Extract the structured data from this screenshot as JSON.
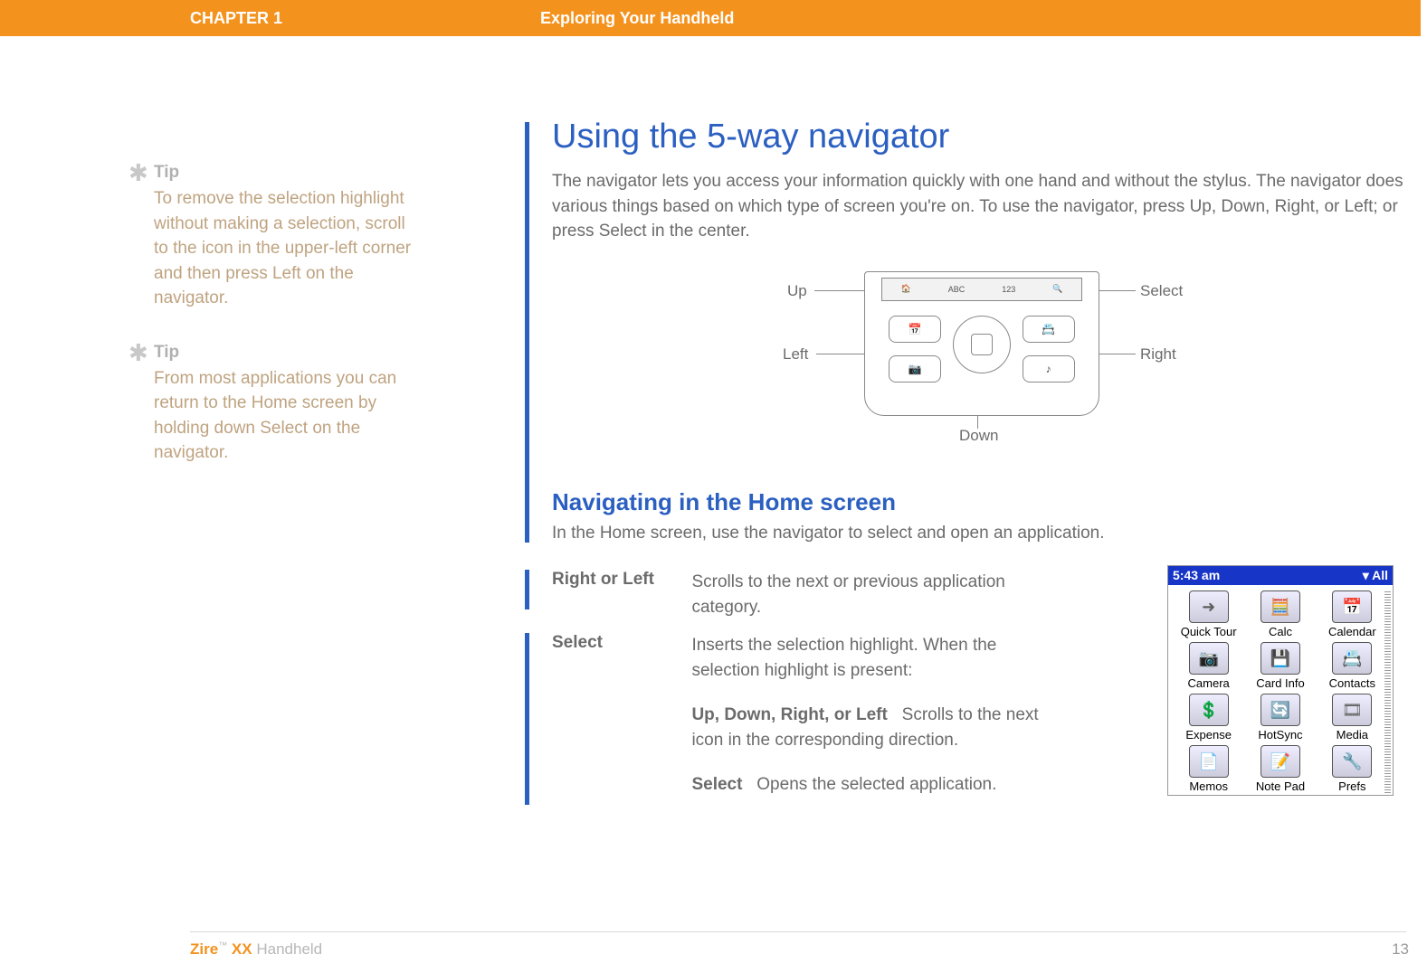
{
  "header": {
    "chapter": "CHAPTER 1",
    "title": "Exploring Your Handheld"
  },
  "tips": [
    {
      "label": "Tip",
      "body": "To remove the selection highlight without making a selection, scroll to the icon in the upper-left corner and then press Left on the navigator."
    },
    {
      "label": "Tip",
      "body": "From most applications you can return to the Home screen by holding down Select on the navigator."
    }
  ],
  "section": {
    "title": "Using the 5-way navigator",
    "lead": "The navigator lets you access your information quickly with one hand and without the stylus. The navigator does various things based on which type of screen you're on. To use the navigator, press Up, Down, Right, or Left; or press Select in the center."
  },
  "nav_labels": {
    "up": "Up",
    "left": "Left",
    "down": "Down",
    "right": "Right",
    "select": "Select"
  },
  "subsection": {
    "title": "Navigating in the Home screen",
    "lead": "In the Home screen, use the navigator to select and open an application."
  },
  "behaviors": [
    {
      "label": "Right or Left",
      "body": "Scrolls to the next or previous application category."
    },
    {
      "label": "Select",
      "body": "Inserts the selection highlight. When the selection highlight is present:",
      "sub": [
        {
          "k": "Up, Down, Right, or Left",
          "v": "Scrolls to the next icon in the corresponding direction."
        },
        {
          "k": "Select",
          "v": "Opens the selected application."
        }
      ]
    }
  ],
  "handheld": {
    "time": "5:43 am",
    "filter": "▾ All",
    "apps": [
      "Quick Tour",
      "Calc",
      "Calendar",
      "Camera",
      "Card Info",
      "Contacts",
      "Expense",
      "HotSync",
      "Media",
      "Memos",
      "Note Pad",
      "Prefs"
    ],
    "icons": [
      "➜",
      "🧮",
      "📅",
      "📷",
      "💾",
      "📇",
      "💲",
      "🔄",
      "🎞",
      "📄",
      "📝",
      "🔧"
    ]
  },
  "footer": {
    "brand": "Zire",
    "tm": "™",
    "model": "XX",
    "product": "Handheld",
    "page": "13"
  }
}
